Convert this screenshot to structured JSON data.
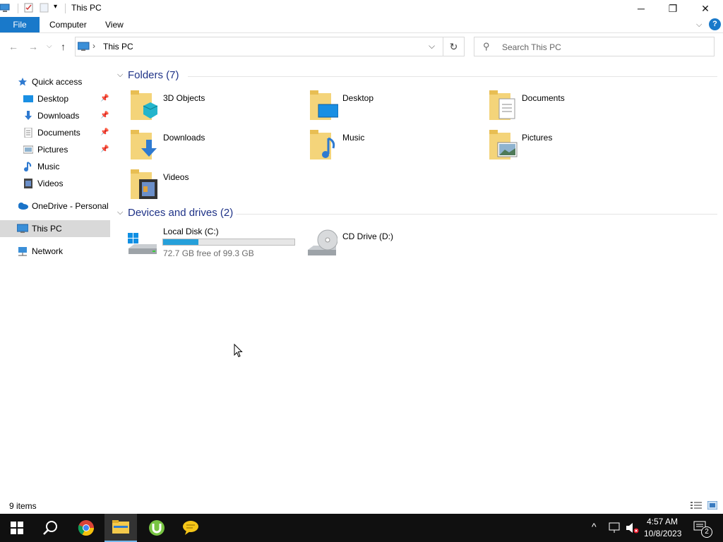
{
  "window": {
    "title": "This PC",
    "minimize_label": "─",
    "restore_label": "❐",
    "close_label": "✕"
  },
  "ribbon": {
    "tabs": [
      "File",
      "Computer",
      "View"
    ],
    "help_label": "?",
    "collapse_label": "⌵"
  },
  "address": {
    "separator": "›",
    "path": "This PC",
    "dropdown": "⌵",
    "refresh": "↻",
    "search_placeholder": "Search This PC"
  },
  "nav": {
    "back": "←",
    "forward": "→",
    "recent": "⌵",
    "up": "↑",
    "quick_access": "Quick access",
    "quick_items": [
      {
        "label": "Desktop",
        "pinned": true
      },
      {
        "label": "Downloads",
        "pinned": true
      },
      {
        "label": "Documents",
        "pinned": true
      },
      {
        "label": "Pictures",
        "pinned": true
      },
      {
        "label": "Music",
        "pinned": false
      },
      {
        "label": "Videos",
        "pinned": false
      }
    ],
    "onedrive": "OneDrive - Personal",
    "thispc": "This PC",
    "network": "Network"
  },
  "content": {
    "folders_header": "Folders (7)",
    "folders": [
      "3D Objects",
      "Desktop",
      "Documents",
      "Downloads",
      "Music",
      "Pictures",
      "Videos"
    ],
    "drives_header": "Devices and drives (2)",
    "drives": [
      {
        "name": "Local Disk (C:)",
        "free_text": "72.7 GB free of 99.3 GB",
        "used_fraction": 0.27
      },
      {
        "name": "CD Drive (D:)"
      }
    ]
  },
  "status": {
    "items_count": "9 items"
  },
  "taskbar": {
    "time": "4:57 AM",
    "date": "10/8/2023",
    "notification_count": "2",
    "accent": "#1979ca"
  }
}
